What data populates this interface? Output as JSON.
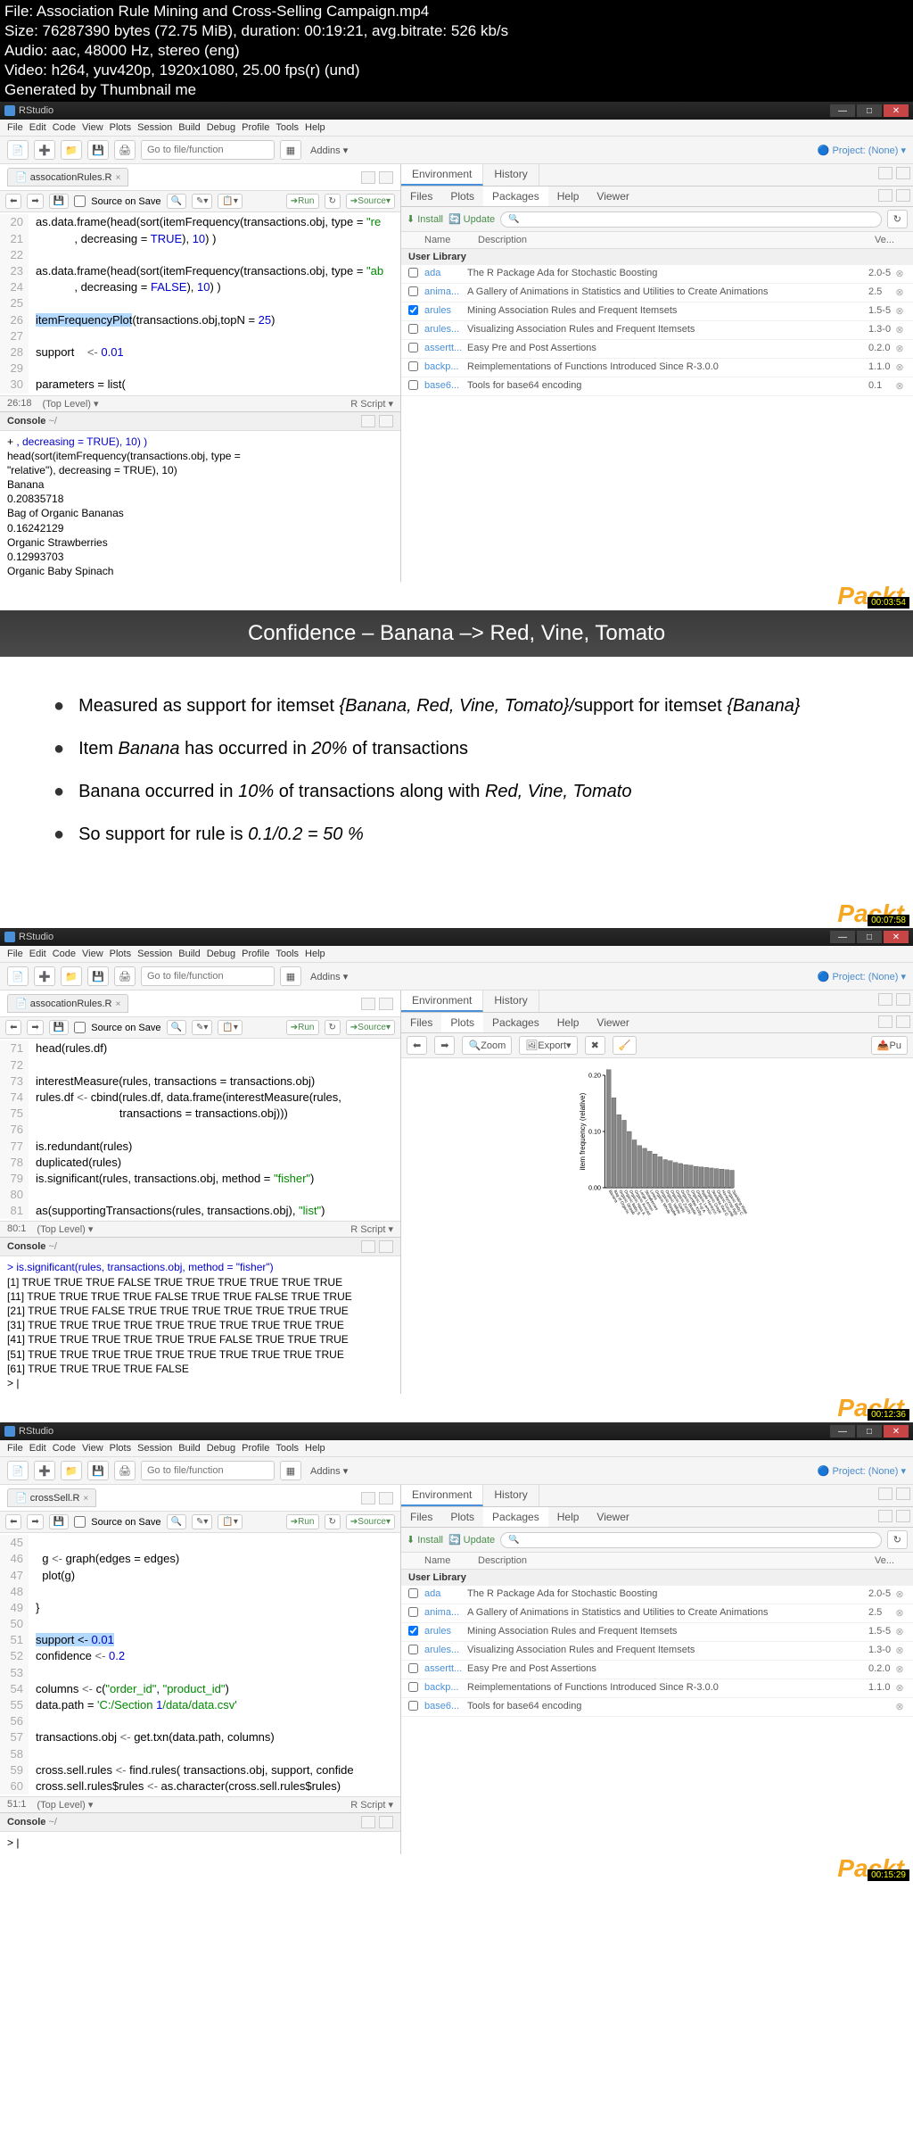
{
  "meta": {
    "file": "File: Association Rule Mining and Cross-Selling Campaign.mp4",
    "size": "Size: 76287390 bytes (72.75 MiB), duration: 00:19:21, avg.bitrate: 526 kb/s",
    "audio": "Audio: aac, 48000 Hz, stereo (eng)",
    "video": "Video: h264, yuv420p, 1920x1080, 25.00 fps(r) (und)",
    "gen": "Generated by Thumbnail me"
  },
  "menu": [
    "File",
    "Edit",
    "Code",
    "View",
    "Plots",
    "Session",
    "Build",
    "Debug",
    "Profile",
    "Tools",
    "Help"
  ],
  "toolbar": {
    "gotofile": "Go to file/function",
    "addins": "Addins",
    "project": "Project: (None)"
  },
  "editorToolbar": {
    "sourceOnSave": "Source on Save",
    "run": "Run",
    "source": "Source"
  },
  "shot1": {
    "top": "RStudio",
    "fileTab": "assocationRules.R",
    "code": [
      {
        "n": "20",
        "t": "as.data.frame(head(sort(itemFrequency(transactions.obj, type = ",
        "suffix": "\"re"
      },
      {
        "n": "21",
        "t": "            , decreasing = TRUE), 10) )"
      },
      {
        "n": "22",
        "t": ""
      },
      {
        "n": "23",
        "t": "as.data.frame(head(sort(itemFrequency(transactions.obj, type = ",
        "suffix": "\"ab"
      },
      {
        "n": "24",
        "t": "            , decreasing = FALSE), 10) )"
      },
      {
        "n": "25",
        "t": ""
      },
      {
        "n": "26",
        "t": "itemFrequencyPlot(transactions.obj,topN = 25)",
        "sel": true
      },
      {
        "n": "27",
        "t": ""
      },
      {
        "n": "28",
        "t": "support    <- 0.01"
      },
      {
        "n": "29",
        "t": ""
      },
      {
        "n": "30",
        "t": "parameters = list("
      }
    ],
    "status": {
      "pos": "26:18",
      "level": "(Top Level)",
      "lang": "R Script"
    },
    "console": {
      "title": "Console",
      "path": "~/",
      "lines": [
        "+         , decreasing = TRUE), 10) )",
        "                 head(sort(itemFrequency(transactions.obj, type =",
        " \"relative\"), decreasing = TRUE), 10)",
        "Banana                                  Bag of Organic Bananas",
        "                   0.20835718                   0.16242129",
        "Organic Strawberries                    Organic Baby Spinach",
        "                   0.12993703"
      ],
      "display": [
        {
          "pre": "+         ",
          "blue": ", decreasing = TRUE), 10) )"
        },
        {
          "pre": "                 head(sort(itemFrequency(transactions.obj, type ="
        },
        {
          "pre": " \"relative\"), decreasing = TRUE), 10)"
        },
        {
          "pre": "Banana"
        },
        {
          "pre": "                   0.20835718"
        },
        {
          "pre": "Bag of Organic Bananas"
        },
        {
          "pre": "                   0.16242129"
        },
        {
          "pre": "Organic Strawberries"
        },
        {
          "pre": "                   0.12993703"
        },
        {
          "pre": "Organic Baby Spinach"
        }
      ]
    },
    "envTabs": [
      "Environment",
      "History"
    ],
    "pkgTabs": [
      "Files",
      "Plots",
      "Packages",
      "Help",
      "Viewer"
    ],
    "pkgActive": "Packages",
    "pkgToolbar": {
      "install": "Install",
      "update": "Update"
    },
    "pkgHeaders": {
      "name": "Name",
      "desc": "Description",
      "ver": "Ve..."
    },
    "userLib": "User Library",
    "packages": [
      {
        "checked": false,
        "name": "ada",
        "desc": "The R Package Ada for Stochastic Boosting",
        "ver": "2.0-5"
      },
      {
        "checked": false,
        "name": "anima...",
        "desc": "A Gallery of Animations in Statistics and Utilities to Create Animations",
        "ver": "2.5"
      },
      {
        "checked": true,
        "name": "arules",
        "desc": "Mining Association Rules and Frequent Itemsets",
        "ver": "1.5-5"
      },
      {
        "checked": false,
        "name": "arules...",
        "desc": "Visualizing Association Rules and Frequent Itemsets",
        "ver": "1.3-0"
      },
      {
        "checked": false,
        "name": "assertt...",
        "desc": "Easy Pre and Post Assertions",
        "ver": "0.2.0"
      },
      {
        "checked": false,
        "name": "backp...",
        "desc": "Reimplementations of Functions Introduced Since R-3.0.0",
        "ver": "1.1.0"
      },
      {
        "checked": false,
        "name": "base6...",
        "desc": "Tools for base64 encoding",
        "ver": "0.1"
      }
    ],
    "watermark": "Packt",
    "timestamp": "00:03:54"
  },
  "slide": {
    "title": "Confidence – Banana –> Red, Vine, Tomato",
    "bullets": [
      {
        "pre": "Measured as support for itemset ",
        "em1": "{Banana, Red, Vine, Tomato}/",
        "mid": "support for itemset ",
        "em2": "{Banana}"
      },
      {
        "pre": "Item ",
        "em1": "Banana",
        "mid": " has occurred in ",
        "em2": "20%",
        "post": " of transactions"
      },
      {
        "pre": "Banana occurred in ",
        "em1": "10%",
        "mid": " of transactions along with ",
        "em2": "Red, Vine, Tomato"
      },
      {
        "pre": "So support for rule is ",
        "em1": "0.1/0.2 = 50 %"
      }
    ],
    "watermark": "Packt",
    "timestamp": "00:07:58"
  },
  "shot2": {
    "fileTab": "assocationRules.R",
    "code": [
      {
        "n": "71",
        "t": "head(rules.df)"
      },
      {
        "n": "72",
        "t": ""
      },
      {
        "n": "73",
        "t": "interestMeasure(rules, transactions = transactions.obj)"
      },
      {
        "n": "74",
        "t": "rules.df <- cbind(rules.df, data.frame(interestMeasure(rules,"
      },
      {
        "n": "75",
        "t": "                          transactions = transactions.obj)))"
      },
      {
        "n": "76",
        "t": ""
      },
      {
        "n": "77",
        "t": "is.redundant(rules)"
      },
      {
        "n": "78",
        "t": "duplicated(rules)"
      },
      {
        "n": "79",
        "t": "is.significant(rules, transactions.obj, method = \"fisher\")"
      },
      {
        "n": "80",
        "t": ""
      },
      {
        "n": "81",
        "t": "as(supportingTransactions(rules, transactions.obj), \"list\")"
      }
    ],
    "status": {
      "pos": "80:1",
      "level": "(Top Level)",
      "lang": "R Script"
    },
    "console": {
      "title": "Console",
      "path": "~/",
      "cmd": "> is.significant(rules, transactions.obj, method = \"fisher\")",
      "rows": [
        " [1]  TRUE  TRUE  TRUE FALSE  TRUE  TRUE  TRUE  TRUE  TRUE  TRUE",
        "[11]  TRUE  TRUE  TRUE  TRUE FALSE  TRUE  TRUE FALSE  TRUE  TRUE",
        "[21]  TRUE  TRUE FALSE  TRUE  TRUE  TRUE  TRUE  TRUE  TRUE  TRUE",
        "[31]  TRUE  TRUE  TRUE  TRUE  TRUE  TRUE  TRUE  TRUE  TRUE  TRUE",
        "[41]  TRUE  TRUE  TRUE  TRUE  TRUE  TRUE FALSE  TRUE  TRUE  TRUE",
        "[51]  TRUE  TRUE  TRUE  TRUE  TRUE  TRUE  TRUE  TRUE  TRUE  TRUE",
        "[61]  TRUE  TRUE  TRUE  TRUE FALSE",
        "> |"
      ]
    },
    "plotTabs": [
      "Files",
      "Plots",
      "Packages",
      "Help",
      "Viewer"
    ],
    "plotActive": "Plots",
    "plotToolbar": {
      "zoom": "Zoom",
      "export": "Export",
      "pu": "Pu"
    },
    "chart_data": {
      "type": "bar",
      "ylabel": "item frequency (relative)",
      "ylim": [
        0.0,
        0.2
      ],
      "yticks": [
        0.0,
        0.1,
        0.2
      ],
      "values": [
        0.21,
        0.16,
        0.13,
        0.12,
        0.1,
        0.085,
        0.075,
        0.07,
        0.065,
        0.06,
        0.055,
        0.05,
        0.048,
        0.045,
        0.043,
        0.041,
        0.04,
        0.038,
        0.037,
        0.036,
        0.035,
        0.034,
        0.033,
        0.032,
        0.031
      ],
      "categories": [
        "Banana",
        "Bag of Organic Bananas",
        "Organic Strawberries",
        "Organic Baby Spinach",
        "Organic Hass Avocado",
        "Organic Avocado",
        "Large Lemon",
        "Strawberries",
        "Limes",
        "Organic Whole Milk",
        "Organic Raspberries",
        "Organic Yellow Onion",
        "Organic Garlic",
        "Organic Zucchini",
        "Organic Blueberries",
        "Cucumber Kirby",
        "Organic Fuji Apple",
        "Organic Lemon",
        "Apple Honeycrisp Organic",
        "Organic Grape Tomatoes",
        "Seedless Red Grapes",
        "Organic Cucumber",
        "Honeycrisp Apple",
        "Organic Baby Carrots",
        "Sparkling Water Grapefruit"
      ]
    },
    "watermark": "Packt",
    "timestamp": "00:12:36"
  },
  "shot3": {
    "fileTab": "crossSell.R",
    "code": [
      {
        "n": "45",
        "t": ""
      },
      {
        "n": "46",
        "t": "  g <- graph(edges = edges)"
      },
      {
        "n": "47",
        "t": "  plot(g)"
      },
      {
        "n": "48",
        "t": ""
      },
      {
        "n": "49",
        "t": "}"
      },
      {
        "n": "50",
        "t": ""
      },
      {
        "n": "51",
        "t": "support <- 0.01",
        "sel": true
      },
      {
        "n": "52",
        "t": "confidence <- 0.2"
      },
      {
        "n": "53",
        "t": ""
      },
      {
        "n": "54",
        "t": "columns <- c(\"order_id\", \"product_id\")"
      },
      {
        "n": "55",
        "t": "data.path = 'C:/Section 1/data/data.csv'"
      },
      {
        "n": "56",
        "t": ""
      },
      {
        "n": "57",
        "t": "transactions.obj <- get.txn(data.path, columns)"
      },
      {
        "n": "58",
        "t": ""
      },
      {
        "n": "59",
        "t": "cross.sell.rules <- find.rules( transactions.obj, support, confide"
      },
      {
        "n": "60",
        "t": "cross.sell.rules$rules <- as.character(cross.sell.rules$rules)"
      }
    ],
    "status": {
      "pos": "51:1",
      "level": "(Top Level)",
      "lang": "R Script"
    },
    "console": {
      "title": "Console",
      "path": "~/",
      "prompt": "> |"
    },
    "pkgTabs": [
      "Files",
      "Plots",
      "Packages",
      "Help",
      "Viewer"
    ],
    "packages": [
      {
        "checked": false,
        "name": "ada",
        "desc": "The R Package Ada for Stochastic Boosting",
        "ver": "2.0-5"
      },
      {
        "checked": false,
        "name": "anima...",
        "desc": "A Gallery of Animations in Statistics and Utilities to Create Animations",
        "ver": "2.5"
      },
      {
        "checked": true,
        "name": "arules",
        "desc": "Mining Association Rules and Frequent Itemsets",
        "ver": "1.5-5"
      },
      {
        "checked": false,
        "name": "arules...",
        "desc": "Visualizing Association Rules and Frequent Itemsets",
        "ver": "1.3-0"
      },
      {
        "checked": false,
        "name": "assertt...",
        "desc": "Easy Pre and Post Assertions",
        "ver": "0.2.0"
      },
      {
        "checked": false,
        "name": "backp...",
        "desc": "Reimplementations of Functions Introduced Since R-3.0.0",
        "ver": "1.1.0"
      },
      {
        "checked": false,
        "name": "base6...",
        "desc": "Tools for base64 encoding",
        "ver": ""
      }
    ],
    "watermark": "Packt",
    "timestamp": "00:15:29"
  }
}
